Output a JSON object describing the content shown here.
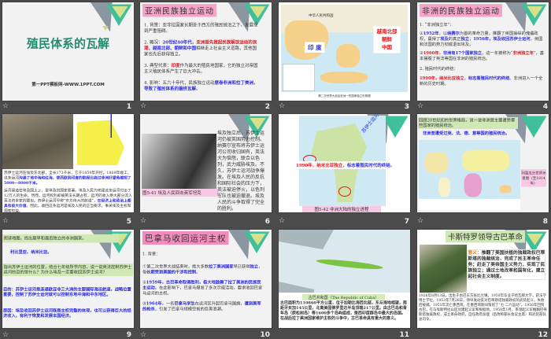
{
  "slides": [
    {
      "number": "1",
      "title": "殖民体系的瓦解",
      "subtitle": "第一PPT模板网-WWW.1PPT.COM"
    },
    {
      "number": "2",
      "heading": "亚洲民族独立运动",
      "items": [
        [
          {
            "t": "1. 背景：亚非拉国家长期处于西方的殖民统治之下，发展受到严重阻碍。"
          }
        ],
        [
          {
            "t": "2. 概况："
          },
          {
            "t": "20世纪40年代，",
            "c": "b"
          },
          {
            "t": "亚洲首先掀起民族解放运动的浪潮",
            "c": "r"
          },
          {
            "t": "，越南北部、朝鲜和中国",
            "c": "b"
          },
          {
            "t": "相继走上社会主义道路，其他国家也先后获得独立。"
          }
        ],
        [
          {
            "t": "3. 典型代表："
          },
          {
            "t": "印度",
            "c": "r"
          },
          {
            "t": "作为最大的殖民地国家，它的独立对帝国主义殖民体系产生了巨大冲击。"
          }
        ],
        [
          {
            "t": "4. 影响：五六十年代，民族独立运动"
          },
          {
            "t": "席卷非洲和拉丁美洲，导致了殖民体系的最终瓦解",
            "c": "b"
          },
          {
            "t": "。"
          }
        ]
      ]
    },
    {
      "number": "3",
      "map_title": "中华人民共和国",
      "label_india": "印 度",
      "label_right": [
        "越南北部",
        "朝鲜",
        "中国"
      ],
      "caption": "第二次世界大战后亚洲一些国家独立形势图"
    },
    {
      "number": "4",
      "heading": "非洲的民族独立运动",
      "items": [
        [
          {
            "t": "1. “非洲独立年”："
          }
        ],
        [
          {
            "t": "①"
          },
          {
            "t": "1952年",
            "c": "b"
          },
          {
            "t": "，以"
          },
          {
            "t": "纳赛尔",
            "c": "b"
          },
          {
            "t": "为首的革命力量，推翻了英国操纵的傀儡政权，赢得了"
          },
          {
            "t": "埃及",
            "c": "b"
          },
          {
            "t": "的真正"
          },
          {
            "t": "独立",
            "c": "b"
          },
          {
            "t": "；"
          },
          {
            "t": "1956年，埃及收回苏伊士运河",
            "c": "b"
          },
          {
            "t": "，英国和法国的势力彻底退出埃及。"
          }
        ],
        [
          {
            "t": "②"
          },
          {
            "t": "1960年",
            "c": "r"
          },
          {
            "t": "，"
          },
          {
            "t": "非洲有17个国家独立",
            "c": "b"
          },
          {
            "t": "，这一年被称为“"
          },
          {
            "t": "非洲独立年",
            "c": "r"
          },
          {
            "t": "”，基本摆脱了英法等国在非洲的殖民统治。"
          }
        ],
        [
          {
            "t": "2. 殖民时代的终结："
          }
        ],
        [
          {
            "t": "      "
          },
          {
            "t": "1990年，纳米比亚独立",
            "c": "r"
          },
          {
            "t": "，"
          },
          {
            "t": "标志着殖民时代的终结",
            "c": "b"
          },
          {
            "t": "。非洲进入一个全新的历史时期。"
          }
        ]
      ]
    },
    {
      "number": "5",
      "text": [
        [
          {
            "t": "    苏伊士运河在埃及东北部，全长173千米，它于1859年开挖，1869年竣工。这条运河"
          },
          {
            "t": "沟通了地中海和红海，使西欧到印度的航程比绕过非洲好望角缩短了5000—8000千米。",
            "c": "b"
          }
        ],
        [
          {
            "t": "    运河建造在埃及国土上，是埃及的国家要塞。埃及人民为修建这条运河付出了12万人的生命。然而，运河权利却被英法长期占有，运河的收入绝大部分流入英法资本家的腰包。苏伊士运河号称“东方伟大的航道”，"
          },
          {
            "t": "在经济上和政治上都具有极大价值",
            "c": "b"
          },
          {
            "t": "。因此，收回这条运河是埃及人民的正当要求，事关埃及主权和国家权益。"
          }
        ]
      ]
    },
    {
      "number": "6",
      "text": "    埃及独立后，苏伊士运河仍被英国势力控制。纳赛尔宣布将苏伊士运河公司收归国有，英法大为恼怒，联合以色列，武力威胁埃及。不久，苏伊士运河战争爆发。在埃及人民的反抗和国际社会的压力下，英法被迫停火，以色列军队也被迫撤退。埃及人民的斗争取得了完全的胜利。",
      "caption": "图5-41 埃及人民回击英军坦克"
    },
    {
      "number": "7",
      "canal_label": "苏伊士运河",
      "banner": [
        {
          "t": "1990年，纳米比亚独立",
          "c": "r"
        },
        {
          "t": "，"
        },
        {
          "t": "标志着殖民时代的终结",
          "c": "b"
        },
        {
          "t": "。"
        }
      ],
      "caption": "图5-42 非洲大陆的独立进程"
    },
    {
      "number": "8",
      "question": "    回顾20世纪初的世界格局，说一说非洲曾主要遭受哪些国家的殖民统治。",
      "answer": "非洲曾遭受过英、法、德、意等国的殖民统治。",
      "map_label": "列强瓜分世界示意图（至1914年）"
    },
    {
      "number": "9",
      "q1": "    阅读地图，找出最早和最后独立的非洲国家。",
      "a1": "利比里亚、纳米比亚。",
      "q2": "    指出苏伊士运河的位置，结合七年级所学内容，说一说英法控制苏伊士运河的目的是什么？为什么埃及一定要收回苏伊士运河？",
      "a2": "目的：苏伊士运河是连通欧亚非三大洲的主要国际海运航道，战略位置重要，控制了苏伊士运河就可以控制东地中海和中东地区。",
      "a3": "原因：埃及收回苏伊士运河既是主权完整的体现，也可以获得巨大的经济收入，有利于恢复和发展本国经济。"
    },
    {
      "number": "10",
      "heading": "巴拿马收回运河主权",
      "items": [
        [
          {
            "t": "1. 背景："
          }
        ],
        [
          {
            "t": "①第二次世界大战结束时，绝大多数"
          },
          {
            "t": "拉丁美洲国家",
            "c": "b"
          },
          {
            "t": "早已获得"
          },
          {
            "t": "独立",
            "c": "b"
          },
          {
            "t": "，但"
          },
          {
            "t": "长期受到美国的干涉和控制",
            "c": "b"
          },
          {
            "t": "。"
          }
        ],
        [
          {
            "t": "②"
          },
          {
            "t": "1959年，古巴革命取得胜利，极大地鼓舞了拉丁美洲的民族民主运动",
            "c": "b"
          },
          {
            "t": "。在此影响下，巴拿马爆发了多次示威活动，要求收回巴拿马运河的主权。"
          }
        ],
        [
          {
            "t": "③"
          },
          {
            "t": "1964年",
            "c": "b"
          },
          {
            "t": "，一名"
          },
          {
            "t": "巴拿马学生",
            "c": "b"
          },
          {
            "t": "在运河区升起巴拿马国旗，"
          },
          {
            "t": "遭到美军的枪杀",
            "c": "b"
          },
          {
            "t": "，引发了巴拿马规模空前的反美浪潮。"
          }
        ]
      ]
    },
    {
      "number": "11",
      "caption": "古巴共和国（The Republic of Cuba）",
      "text": "    古巴面积为110860平方公里，位于加勒比海西北部，东与海地相望，南距牙买加145公里，北离美国佛罗里达半岛顶端217公里。由古巴岛和青年岛（原松树岛）等1600多个岛屿组成，是西印度群岛中最大的岛国。在战后拉丁美洲国家维护主权的斗争中，古巴革命具有重大的意义。"
    },
    {
      "number": "12",
      "heading": "卡斯特罗领导古巴革命",
      "meaning_label": "意义：",
      "meaning": "推翻了美国扶植的独裁政权巴蒂斯塔的独裁统治，完成了民主革命任务；赶走了美帝国主义势力，实现了民族独立；通过土地改革和国有化，建立起社会主义制度。",
      "bio": "    1926年8月13日，出生于古巴东方省比兰镇。1950年毕业于哈瓦那大学，获法学博士学位。1953年7月26日，领导发动反对巴蒂斯塔独裁政权的武装起义，失败后被捕。1955年流亡墨西哥。在墨西哥期间策划了“七·二六运动”。1956年回到古巴，在马埃斯特拉山区创建起义军和根据地。1959年1月，率领起义军推翻巴蒂斯塔独裁政权，成立革命政府，自任政府总理（后改称部长会议主席）和武装部队总司令。"
    }
  ],
  "star_icon": "☆",
  "colors": {
    "background": "#4b4b4b",
    "title_green": "#1f8a6a",
    "heading_pink": "#f4a6c8",
    "red": "#e8141b",
    "blue": "#2a2ae6"
  }
}
